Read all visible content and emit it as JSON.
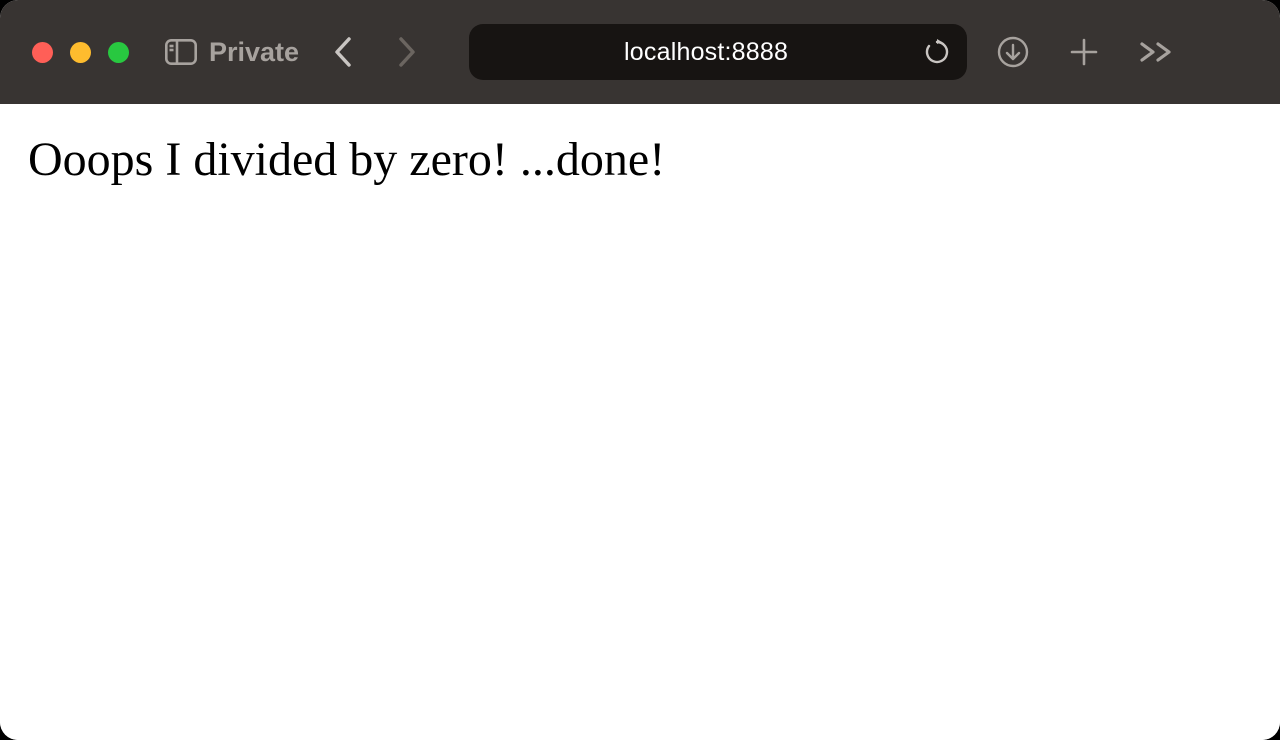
{
  "toolbar": {
    "sidebar_label": "Private",
    "address": "localhost:8888"
  },
  "page": {
    "body_text": "Ooops I divided by zero! ...done!"
  }
}
